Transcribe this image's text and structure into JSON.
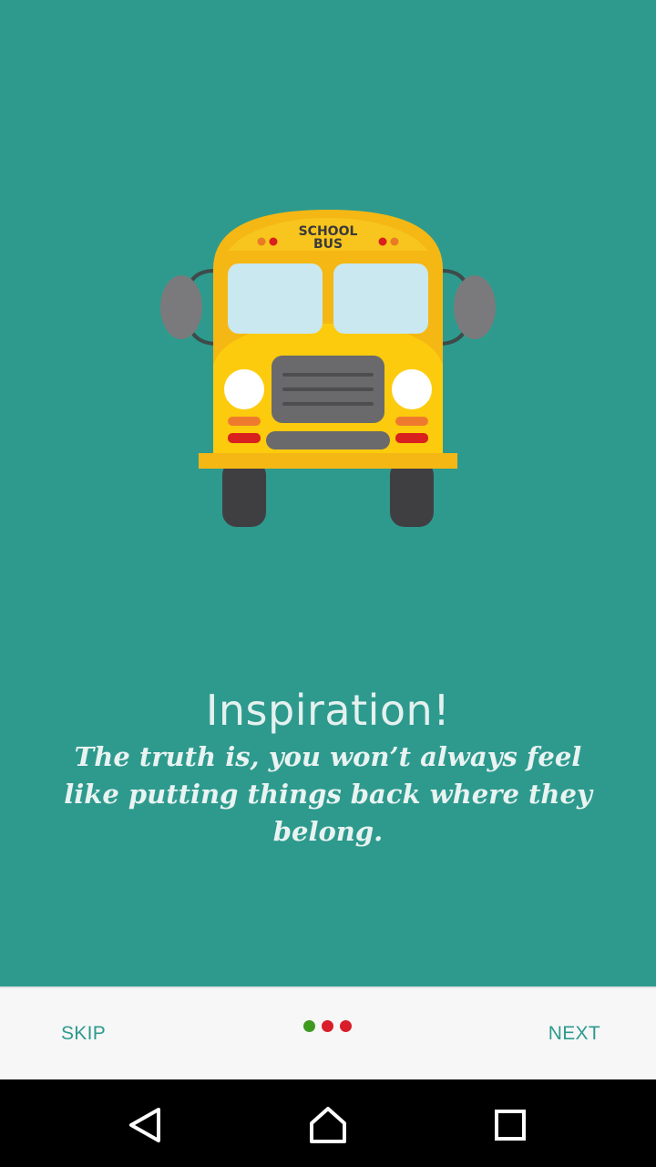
{
  "onboarding": {
    "title": "Inspiration!",
    "body": "The truth is, you won’t always feel like putting things back where they belong.",
    "illustration": {
      "icon": "school-bus-icon",
      "sign_line1": "SCHOOL",
      "sign_line2": "BUS"
    },
    "background_color": "#2E9A8E"
  },
  "bottom_bar": {
    "skip_label": "SKIP",
    "next_label": "NEXT",
    "page_indicator": {
      "total": 3,
      "current": 1,
      "dot_colors": [
        "#3E9A1E",
        "#D81E2A",
        "#D81E2A"
      ]
    }
  },
  "system_nav": {
    "back_icon": "back-triangle-icon",
    "home_icon": "home-icon",
    "recents_icon": "recents-square-icon"
  }
}
